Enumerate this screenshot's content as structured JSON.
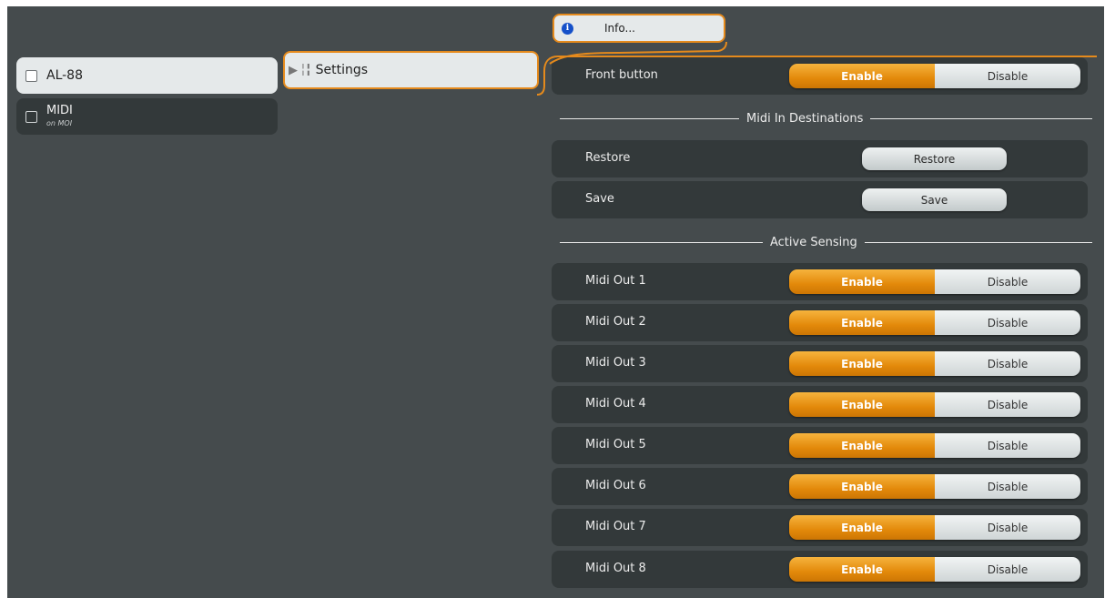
{
  "devices": [
    {
      "name": "AL-88",
      "sub": ""
    },
    {
      "name": "MIDI",
      "sub": "on MOI"
    }
  ],
  "settings_tab": {
    "arrow": "▶",
    "icon": "sliders-icon",
    "label": "Settings"
  },
  "info_tab": {
    "label": "Info...",
    "icon": "info-icon"
  },
  "front_button": {
    "label": "Front button",
    "enable": "Enable",
    "disable": "Disable",
    "state": "Enable"
  },
  "midi_in": {
    "title": "Midi In Destinations",
    "restore": {
      "label": "Restore",
      "button": "Restore"
    },
    "save": {
      "label": "Save",
      "button": "Save"
    }
  },
  "active_sensing": {
    "title": "Active Sensing",
    "outputs": [
      {
        "label": "Midi Out 1",
        "enable": "Enable",
        "disable": "Disable",
        "state": "Enable"
      },
      {
        "label": "Midi Out 2",
        "enable": "Enable",
        "disable": "Disable",
        "state": "Enable"
      },
      {
        "label": "Midi Out 3",
        "enable": "Enable",
        "disable": "Disable",
        "state": "Enable"
      },
      {
        "label": "Midi Out 4",
        "enable": "Enable",
        "disable": "Disable",
        "state": "Enable"
      },
      {
        "label": "Midi Out 5",
        "enable": "Enable",
        "disable": "Disable",
        "state": "Enable"
      },
      {
        "label": "Midi Out 6",
        "enable": "Enable",
        "disable": "Disable",
        "state": "Enable"
      },
      {
        "label": "Midi Out 7",
        "enable": "Enable",
        "disable": "Disable",
        "state": "Enable"
      },
      {
        "label": "Midi Out 8",
        "enable": "Enable",
        "disable": "Disable",
        "state": "Enable"
      }
    ]
  },
  "colors": {
    "accent": "#e58a1c",
    "panel": "#454b4d",
    "row": "#33393a"
  }
}
